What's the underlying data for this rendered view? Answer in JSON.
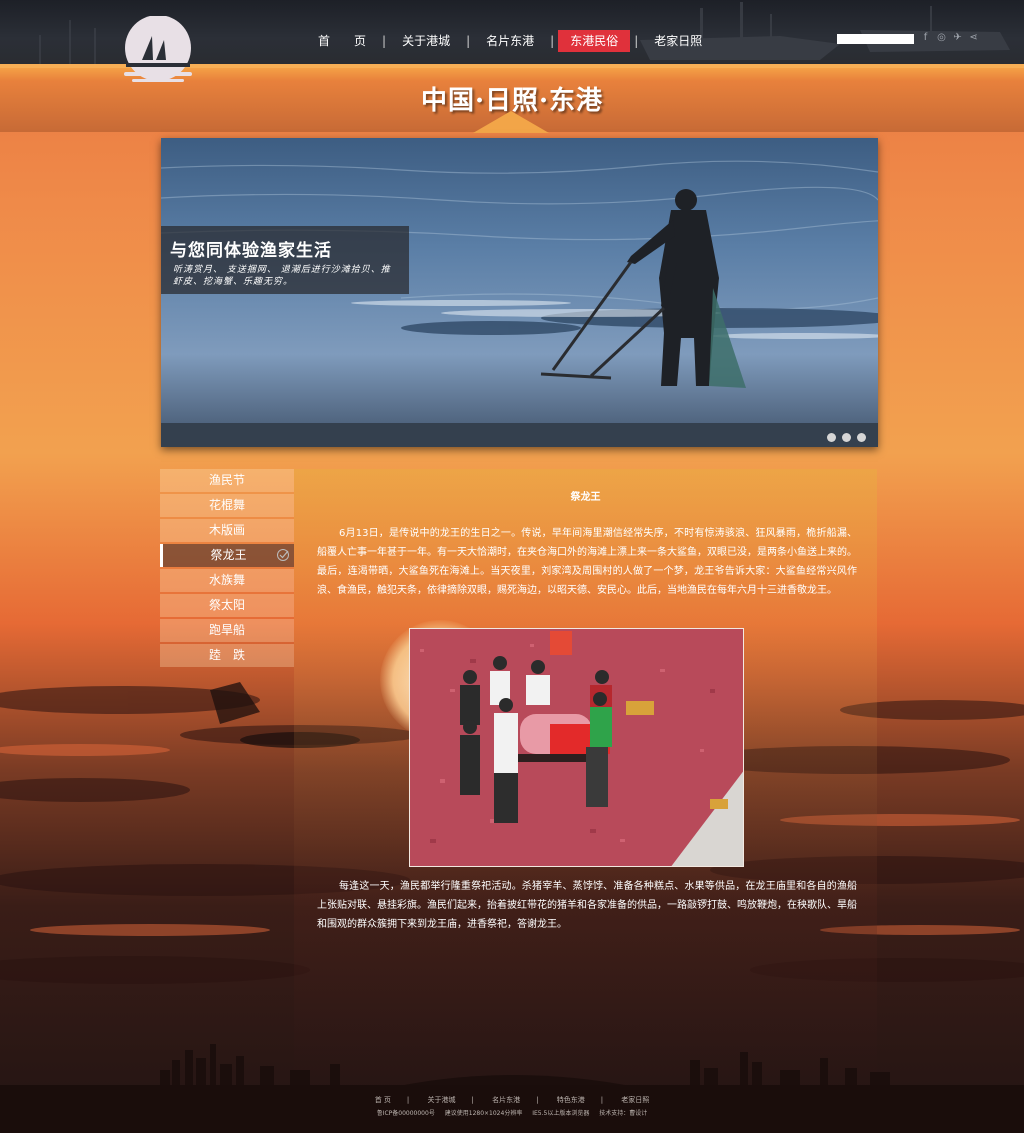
{
  "header": {
    "nav": [
      {
        "label": "首　　页",
        "active": false
      },
      {
        "label": "关于港城",
        "active": false
      },
      {
        "label": "名片东港",
        "active": false
      },
      {
        "label": "东港民俗",
        "active": true
      },
      {
        "label": "老家日照",
        "active": false
      }
    ],
    "nav_separator": "|",
    "search_placeholder": "",
    "social_icons": [
      "facebook-icon",
      "dribbble-icon",
      "twitter-icon",
      "share-icon"
    ],
    "accent_color": "#e0313b"
  },
  "band": {
    "title": "中国·日照·东港"
  },
  "banner": {
    "headline": "与您同体验渔家生活",
    "subtext": "听涛赏月、 支送捆网、 退潮后进行沙滩拾贝、推虾皮、挖海蟹、乐趣无穷。",
    "slide_count": 3
  },
  "sidemenu": {
    "items": [
      {
        "label": "渔民节",
        "active": false
      },
      {
        "label": "花棍舞",
        "active": false
      },
      {
        "label": "木版画",
        "active": false
      },
      {
        "label": "祭龙王",
        "active": true
      },
      {
        "label": "水族舞",
        "active": false
      },
      {
        "label": "祭太阳",
        "active": false
      },
      {
        "label": "跑旱船",
        "active": false
      },
      {
        "label": "踛　跌",
        "active": false
      }
    ]
  },
  "article": {
    "title": "祭龙王",
    "paragraph1": "6月13日，是传说中的龙王的生日之一。传说，早年间海里潮信经常失序，不时有惊涛骇浪、狂风暴雨，桅折船漏、船覆人亡事一年甚于一年。有一天大恰潮时，在夹仓海口外的海滩上漂上来一条大鲨鱼，双眼已没，是两条小鱼送上来的。最后，连渴带晒，大鲨鱼死在海滩上。当天夜里，刘家湾及周围村的人做了一个梦，龙王爷告诉大家：大鲨鱼经常兴风作浪、食渔民，触犯天条，依律摘除双眼，赐死海边，以昭天德、安民心。此后，当地渔民在每年六月十三进香敬龙王。",
    "paragraph2": "每逢这一天，渔民都举行隆重祭祀活动。杀猪宰羊、蒸饽饽、准备各种糕点、水果等供品，在龙王庙里和各自的渔船上张贴对联、悬挂彩旗。渔民们起来，抬着披红带花的猪羊和各家准备的供品，一路敲锣打鼓、鸣放鞭炮，在秧歌队、旱船和围观的群众簇拥下来到龙王庙，进香祭祀，答谢龙王。"
  },
  "footer": {
    "nav": [
      "首 页",
      "关于港城",
      "名片东港",
      "特色东港",
      "老家日照"
    ],
    "separator": "|",
    "info": [
      "鲁ICP备00000000号",
      "建议使用1280×1024分辨率",
      "IE5.5以上版本浏览器",
      "技术支持：曹设计"
    ]
  }
}
